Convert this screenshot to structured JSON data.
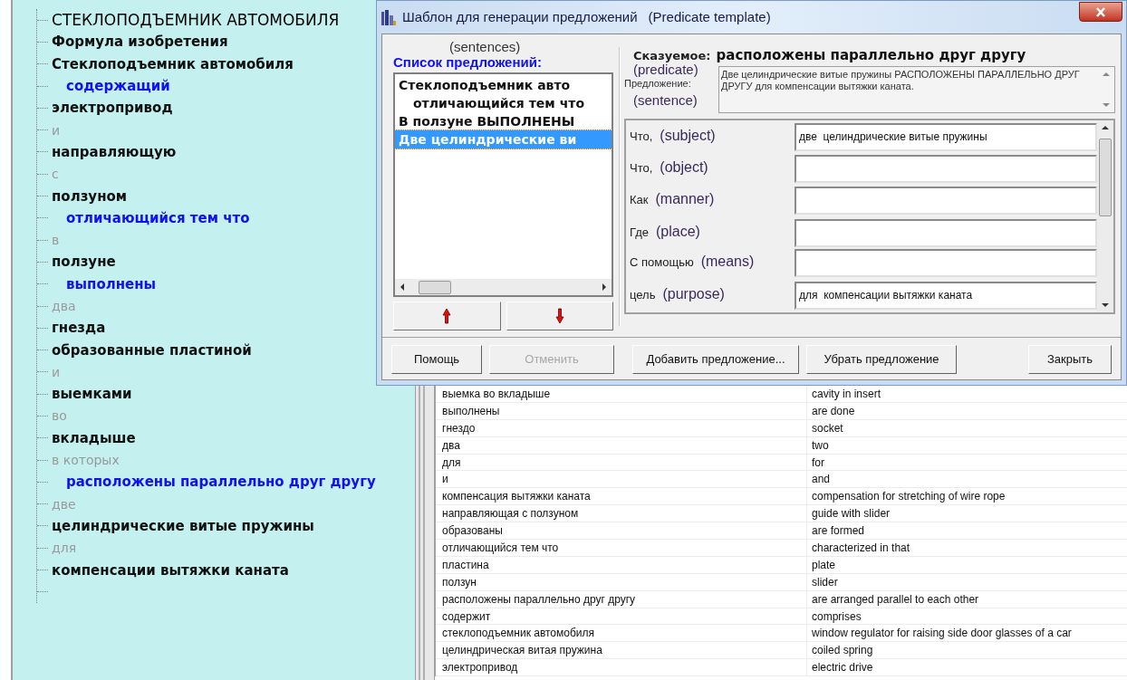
{
  "tree": {
    "items": [
      {
        "kind": "title",
        "text": "СТЕКЛОПОДЪЕМНИК АВТОМОБИЛЯ"
      },
      {
        "kind": "main",
        "text": "Формула изобретения"
      },
      {
        "kind": "main",
        "text": "Стеклоподъемник автомобиля"
      },
      {
        "kind": "predicate",
        "text": "содержащий"
      },
      {
        "kind": "main",
        "text": "электропривод"
      },
      {
        "kind": "connector",
        "text": "и"
      },
      {
        "kind": "main",
        "text": "направляющую"
      },
      {
        "kind": "connector",
        "text": "с"
      },
      {
        "kind": "main",
        "text": "ползуном"
      },
      {
        "kind": "predicate",
        "text": "отличающийся тем что"
      },
      {
        "kind": "connector",
        "text": "в"
      },
      {
        "kind": "main",
        "text": "ползуне"
      },
      {
        "kind": "predicate",
        "text": "выполнены"
      },
      {
        "kind": "connector",
        "text": "два"
      },
      {
        "kind": "main",
        "text": "гнезда"
      },
      {
        "kind": "main",
        "text": "образованные пластиной"
      },
      {
        "kind": "connector",
        "text": "и"
      },
      {
        "kind": "main",
        "text": "выемками"
      },
      {
        "kind": "connector",
        "text": "во"
      },
      {
        "kind": "main",
        "text": "вкладыше"
      },
      {
        "kind": "connector",
        "text": "в которых"
      },
      {
        "kind": "predicate",
        "text": "расположены параллельно друг другу"
      },
      {
        "kind": "connector",
        "text": "две"
      },
      {
        "kind": "main",
        "text": "целиндрические витые пружины"
      },
      {
        "kind": "connector",
        "text": "для"
      },
      {
        "kind": "main",
        "text": "компенсации вытяжки каната"
      }
    ]
  },
  "dictionary": {
    "rows": [
      [
        "выемка во вкладыше",
        "cavity in insert"
      ],
      [
        "выполнены",
        "are done"
      ],
      [
        "гнездо",
        "socket"
      ],
      [
        "два",
        "two"
      ],
      [
        "для",
        "for"
      ],
      [
        "и",
        "and"
      ],
      [
        "компенсация вытяжки каната",
        "compensation for stretching of wire rope"
      ],
      [
        "направляющая с ползуном",
        "guide with slider"
      ],
      [
        "образованы",
        "are formed"
      ],
      [
        "отличающийся тем что",
        "characterized in that"
      ],
      [
        "пластина",
        "plate"
      ],
      [
        "ползун",
        "slider"
      ],
      [
        "расположены параллельно друг другу",
        "are arranged parallel to each other"
      ],
      [
        "содержит",
        "comprises"
      ],
      [
        "стеклоподъемник автомобиля",
        "window regulator for raising side door glasses of a car"
      ],
      [
        "целиндрическая витая пружина",
        "coiled spring"
      ],
      [
        "электропривод",
        "electric drive"
      ]
    ]
  },
  "dialog": {
    "title": "Шаблон для генерации предложений",
    "title_en": "(Predicate template)",
    "list_hint": "(sentences)",
    "list_label": "Список предложений:",
    "sentences": [
      {
        "text": "Стеклоподъемник авто",
        "indent": false,
        "selected": false
      },
      {
        "text": "отличающийся тем что",
        "indent": true,
        "selected": false
      },
      {
        "text": "В ползуне ВЫПОЛНЕНЫ",
        "indent": false,
        "selected": false
      },
      {
        "text": "Две целиндрические ви",
        "indent": false,
        "selected": true
      }
    ],
    "predicate_label": "Сказуемое:",
    "predicate_hint": "(predicate)",
    "predicate": "расположены параллельно друг другу",
    "sentence_label": "Предложение:",
    "sentence_hint": "(sentence)",
    "sentence": "Две целиндрические витые пружины РАСПОЛОЖЕНЫ ПАРАЛЛЕЛЬНО ДРУГ ДРУГУ для компенсации вытяжки каната.",
    "fields": [
      {
        "label": "Что,",
        "hint": "(subject)",
        "value": "две  целиндрические витые пружины"
      },
      {
        "label": "Что,",
        "hint": "(object)"
      },
      {
        "label": "Как",
        "hint": "(manner)"
      },
      {
        "label": "Где",
        "hint": "(place)"
      },
      {
        "label": "С помощью",
        "hint": "(means)"
      },
      {
        "label": "цель",
        "hint": "(purpose)",
        "value": "для  компенсации вытяжки каната"
      }
    ],
    "buttons": [
      {
        "text": "Помощь",
        "disabled": false
      },
      {
        "text": "Отменить",
        "disabled": true
      },
      {
        "text": "Добавить предложение...",
        "disabled": false
      },
      {
        "text": "Убрать предложение",
        "disabled": false
      },
      {
        "text": "Закрыть",
        "disabled": false
      }
    ]
  }
}
